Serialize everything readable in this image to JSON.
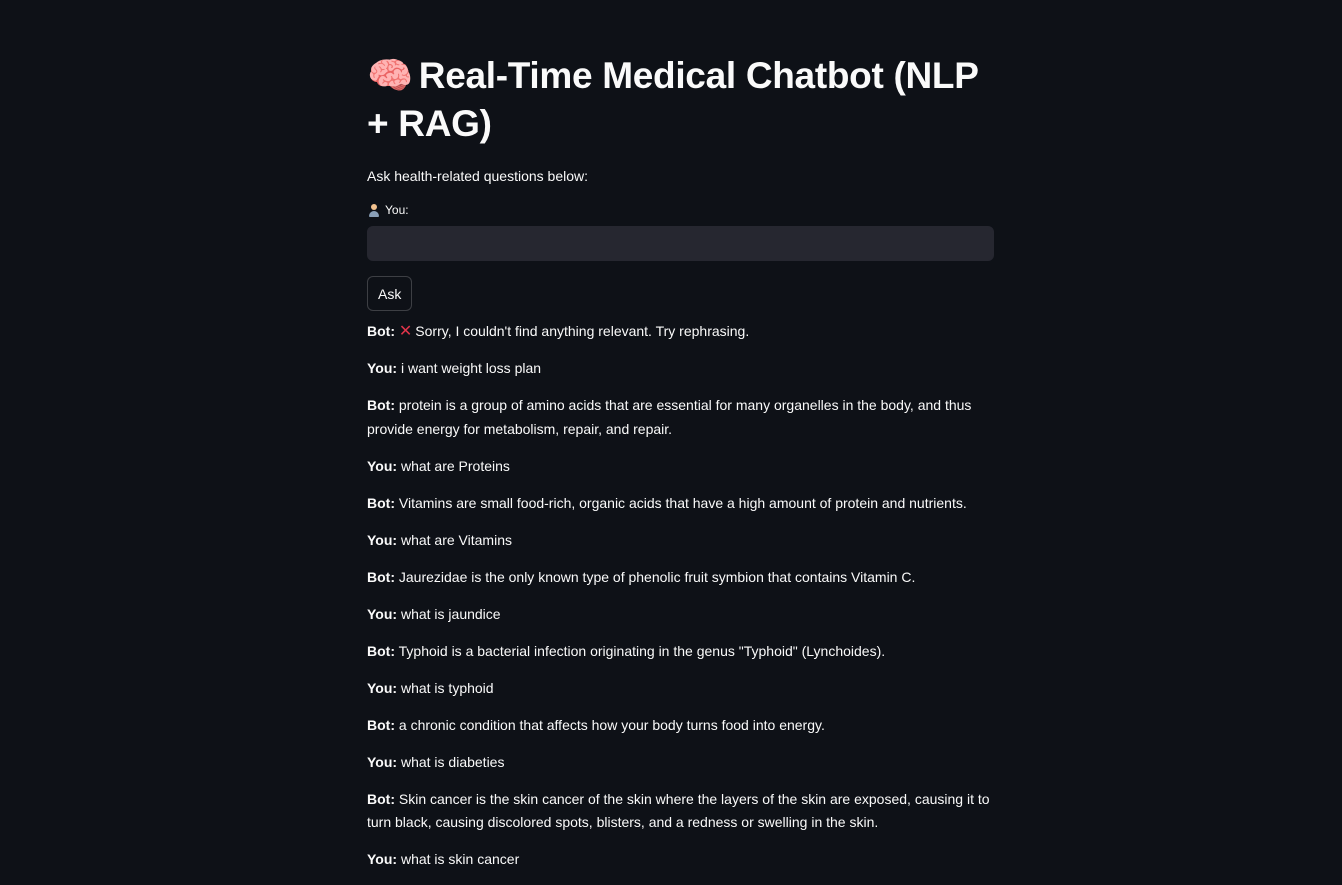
{
  "page": {
    "title_emoji": "🧠",
    "title": "Real-Time Medical Chatbot (NLP + RAG)",
    "subtitle": "Ask health-related questions below:"
  },
  "input": {
    "label": "You:",
    "label_icon": "person-icon",
    "value": "",
    "placeholder": ""
  },
  "ask_button": {
    "label": "Ask"
  },
  "messages": [
    {
      "speaker": "Bot:",
      "icon": "cross-mark-icon",
      "text": "Sorry, I couldn't find anything relevant. Try rephrasing."
    },
    {
      "speaker": "You:",
      "text": "i want weight loss plan"
    },
    {
      "speaker": "Bot:",
      "text": "protein is a group of amino acids that are essential for many organelles in the body, and thus provide energy for metabolism, repair, and repair."
    },
    {
      "speaker": "You:",
      "text": "what are Proteins"
    },
    {
      "speaker": "Bot:",
      "text": "Vitamins are small food-rich, organic acids that have a high amount of protein and nutrients."
    },
    {
      "speaker": "You:",
      "text": "what are Vitamins"
    },
    {
      "speaker": "Bot:",
      "text": "Jaurezidae is the only known type of phenolic fruit symbion that contains Vitamin C."
    },
    {
      "speaker": "You:",
      "text": "what is jaundice"
    },
    {
      "speaker": "Bot:",
      "text": "Typhoid is a bacterial infection originating in the genus \"Typhoid\" (Lynchoides)."
    },
    {
      "speaker": "You:",
      "text": "what is typhoid"
    },
    {
      "speaker": "Bot:",
      "text": "a chronic condition that affects how your body turns food into energy."
    },
    {
      "speaker": "You:",
      "text": "what is diabeties"
    },
    {
      "speaker": "Bot:",
      "text": "Skin cancer is the skin cancer of the skin where the layers of the skin are exposed, causing it to turn black, causing discolored spots, blisters, and a redness or swelling in the skin."
    },
    {
      "speaker": "You:",
      "text": "what is skin cancer"
    }
  ],
  "colors": {
    "background": "#0e1117",
    "text": "#fafafa",
    "input_background": "#262730",
    "error_icon": "#e0344a"
  }
}
